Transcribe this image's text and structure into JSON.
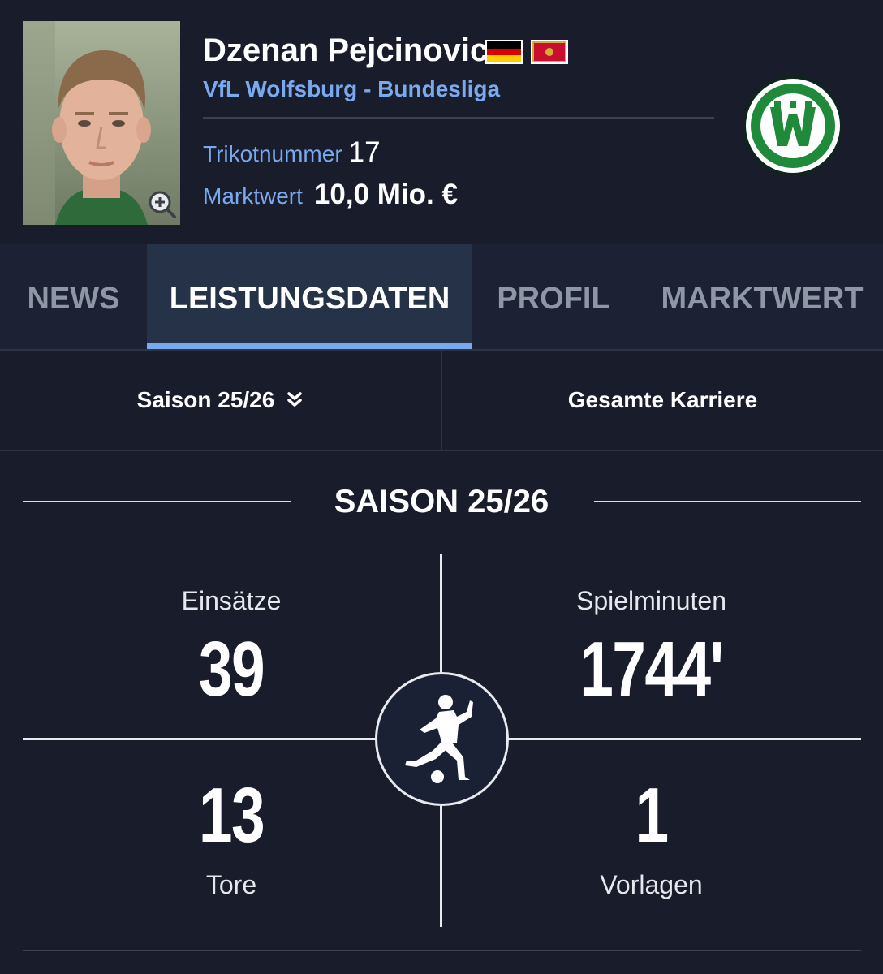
{
  "player": {
    "name": "Dzenan Pejcinovic",
    "club_line": "VfL Wolfsburg - Bundesliga",
    "shirt_label": "Trikotnummer",
    "shirt_number": "17",
    "market_label": "Marktwert",
    "market_value": "10,0 Mio. €",
    "flags": [
      "germany-flag",
      "montenegro-flag"
    ],
    "club_logo": "vfl-wolfsburg-logo"
  },
  "tabs": [
    {
      "label": "NEWS",
      "active": false
    },
    {
      "label": "LEISTUNGSDATEN",
      "active": true
    },
    {
      "label": "PROFIL",
      "active": false
    },
    {
      "label": "MARKTWERT",
      "active": false
    }
  ],
  "filters": {
    "season": "Saison 25/26",
    "career": "Gesamte Karriere"
  },
  "stats": {
    "section_title": "SAISON 25/26",
    "appearances_label": "Einsätze",
    "appearances": "39",
    "minutes_label": "Spielminuten",
    "minutes": "1744'",
    "goals": "13",
    "goals_label": "Tore",
    "assists": "1",
    "assists_label": "Vorlagen"
  },
  "colors": {
    "background": "#181c2b",
    "accent": "#7aa9ef",
    "active_tab": "#263248",
    "wolfsburg_green": "#1f8a3a"
  }
}
